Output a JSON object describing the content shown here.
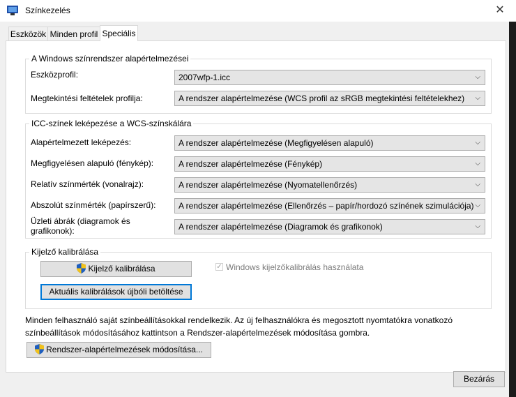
{
  "window": {
    "title": "Színkezelés",
    "close": "✕"
  },
  "tabs": [
    {
      "label": "Eszközök",
      "active": false
    },
    {
      "label": "Minden profil",
      "active": false
    },
    {
      "label": "Speciális",
      "active": true
    }
  ],
  "windows_defaults": {
    "legend": "A Windows színrendszer alapértelmezései",
    "device_profile": {
      "label": "Eszközprofil:",
      "value": "2007wfp-1.icc"
    },
    "viewing_conditions": {
      "label": "Megtekintési feltételek profilja:",
      "value": "A rendszer alapértelmezése (WCS profil az sRGB megtekintési feltételekhez)"
    }
  },
  "icc_mapping": {
    "legend": "ICC-színek leképezése a WCS-színskálára",
    "rows": [
      {
        "label": "Alapértelmezett leképezés:",
        "value": "A rendszer alapértelmezése (Megfigyelésen alapuló)"
      },
      {
        "label": "Megfigyelésen alapuló (fénykép):",
        "value": "A rendszer alapértelmezése (Fénykép)"
      },
      {
        "label": "Relatív színmérték (vonalrajz):",
        "value": "A rendszer alapértelmezése (Nyomatellenőrzés)"
      },
      {
        "label": "Abszolút színmérték (papírszerű):",
        "value": "A rendszer alapértelmezése (Ellenőrzés – papír/hordozó színének szimulációja)"
      },
      {
        "label": "Üzleti ábrák (diagramok és grafikonok):",
        "value": "A rendszer alapértelmezése (Diagramok és grafikonok)"
      }
    ]
  },
  "calibration": {
    "legend": "Kijelző kalibrálása",
    "calibrate_button": "Kijelző kalibrálása",
    "checkbox_label": "Windows kijelzőkalibrálás használata",
    "checkbox_checked": true,
    "reload_button": "Aktuális kalibrálások újbóli betöltése"
  },
  "info_text": "Minden felhasználó saját színbeállításokkal rendelkezik. Az új felhasználókra és megosztott nyomtatókra vonatkozó színbeállítások módosításához kattintson a Rendszer-alapértelmezések módosítása gombra.",
  "change_defaults_button": "Rendszer-alapértelmezések módosítása...",
  "close_button": "Bezárás",
  "chevron": "⌵"
}
